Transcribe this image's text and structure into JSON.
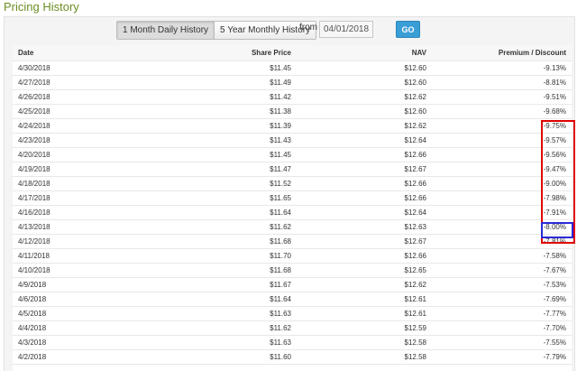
{
  "page": {
    "section_title": "Pricing History"
  },
  "controls": {
    "tab_daily": "1 Month Daily History",
    "tab_monthly": "5 Year Monthly History",
    "from_label": "from",
    "from_date": "04/01/2018",
    "go_label": "GO"
  },
  "table": {
    "columns": [
      "Date",
      "Share Price",
      "NAV",
      "Premium / Discount"
    ],
    "rows": [
      [
        "4/30/2018",
        "$11.45",
        "$12.60",
        "-9.13%"
      ],
      [
        "4/27/2018",
        "$11.49",
        "$12.60",
        "-8.81%"
      ],
      [
        "4/26/2018",
        "$11.42",
        "$12.62",
        "-9.51%"
      ],
      [
        "4/25/2018",
        "$11.38",
        "$12.60",
        "-9.68%"
      ],
      [
        "4/24/2018",
        "$11.39",
        "$12.62",
        "-9.75%"
      ],
      [
        "4/23/2018",
        "$11.43",
        "$12.64",
        "-9.57%"
      ],
      [
        "4/20/2018",
        "$11.45",
        "$12.66",
        "-9.56%"
      ],
      [
        "4/19/2018",
        "$11.47",
        "$12.67",
        "-9.47%"
      ],
      [
        "4/18/2018",
        "$11.52",
        "$12.66",
        "-9.00%"
      ],
      [
        "4/17/2018",
        "$11.65",
        "$12.66",
        "-7.98%"
      ],
      [
        "4/16/2018",
        "$11.64",
        "$12.64",
        "-7.91%"
      ],
      [
        "4/13/2018",
        "$11.62",
        "$12.63",
        "-8.00%"
      ],
      [
        "4/12/2018",
        "$11.68",
        "$12.67",
        "-7.81%"
      ],
      [
        "4/11/2018",
        "$11.70",
        "$12.66",
        "-7.58%"
      ],
      [
        "4/10/2018",
        "$11.68",
        "$12.65",
        "-7.67%"
      ],
      [
        "4/9/2018",
        "$11.67",
        "$12.62",
        "-7.53%"
      ],
      [
        "4/6/2018",
        "$11.64",
        "$12.61",
        "-7.69%"
      ],
      [
        "4/5/2018",
        "$11.63",
        "$12.61",
        "-7.77%"
      ],
      [
        "4/4/2018",
        "$11.62",
        "$12.59",
        "-7.70%"
      ],
      [
        "4/3/2018",
        "$11.63",
        "$12.58",
        "-7.55%"
      ],
      [
        "4/2/2018",
        "$11.60",
        "$12.58",
        "-7.79%"
      ]
    ]
  },
  "colors": {
    "title_green": "#6b8e23",
    "go_blue": "#3a9ed6",
    "highlight_red": "#e00000",
    "highlight_blue": "#2a2ad8"
  }
}
